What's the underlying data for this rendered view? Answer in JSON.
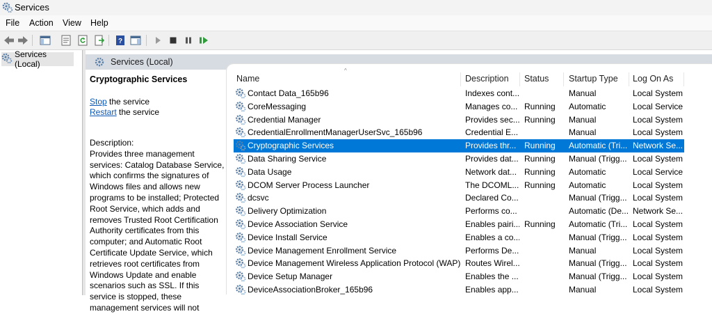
{
  "window": {
    "title": "Services"
  },
  "menu": [
    "File",
    "Action",
    "View",
    "Help"
  ],
  "tree": {
    "root_label": "Services (Local)"
  },
  "header": {
    "title": "Services (Local)"
  },
  "details": {
    "service_name": "Cryptographic Services",
    "stop_link": "Stop",
    "stop_suffix": " the service",
    "restart_link": "Restart",
    "restart_suffix": " the service",
    "description_label": "Description:",
    "description_text": "Provides three management services: Catalog Database Service, which confirms the signatures of Windows files and allows new programs to be installed; Protected Root Service, which adds and removes Trusted Root Certification Authority certificates from this computer; and Automatic Root Certificate Update Service, which retrieves root certificates from Windows Update and enable scenarios such as SSL. If this service is stopped, these management services will not"
  },
  "columns": {
    "name": "Name",
    "description": "Description",
    "status": "Status",
    "startup": "Startup Type",
    "logon": "Log On As"
  },
  "services": [
    {
      "name": "Contact Data_165b96",
      "description": "Indexes cont...",
      "status": "",
      "startup": "Manual",
      "logon": "Local System"
    },
    {
      "name": "CoreMessaging",
      "description": "Manages co...",
      "status": "Running",
      "startup": "Automatic",
      "logon": "Local Service"
    },
    {
      "name": "Credential Manager",
      "description": "Provides sec...",
      "status": "Running",
      "startup": "Manual",
      "logon": "Local System"
    },
    {
      "name": "CredentialEnrollmentManagerUserSvc_165b96",
      "description": "Credential E...",
      "status": "",
      "startup": "Manual",
      "logon": "Local System"
    },
    {
      "name": "Cryptographic Services",
      "description": "Provides thr...",
      "status": "Running",
      "startup": "Automatic (Tri...",
      "logon": "Network Se...",
      "selected": true
    },
    {
      "name": "Data Sharing Service",
      "description": "Provides dat...",
      "status": "Running",
      "startup": "Manual (Trigg...",
      "logon": "Local System"
    },
    {
      "name": "Data Usage",
      "description": "Network dat...",
      "status": "Running",
      "startup": "Automatic",
      "logon": "Local Service"
    },
    {
      "name": "DCOM Server Process Launcher",
      "description": "The DCOML...",
      "status": "Running",
      "startup": "Automatic",
      "logon": "Local System"
    },
    {
      "name": "dcsvc",
      "description": "Declared Co...",
      "status": "",
      "startup": "Manual (Trigg...",
      "logon": "Local System"
    },
    {
      "name": "Delivery Optimization",
      "description": "Performs co...",
      "status": "",
      "startup": "Automatic (De...",
      "logon": "Network Se..."
    },
    {
      "name": "Device Association Service",
      "description": "Enables pairi...",
      "status": "Running",
      "startup": "Automatic (Tri...",
      "logon": "Local System"
    },
    {
      "name": "Device Install Service",
      "description": "Enables a co...",
      "status": "",
      "startup": "Manual (Trigg...",
      "logon": "Local System"
    },
    {
      "name": "Device Management Enrollment Service",
      "description": "Performs De...",
      "status": "",
      "startup": "Manual",
      "logon": "Local System"
    },
    {
      "name": "Device Management Wireless Application Protocol (WAP) ...",
      "description": "Routes Wirel...",
      "status": "",
      "startup": "Manual (Trigg...",
      "logon": "Local System"
    },
    {
      "name": "Device Setup Manager",
      "description": "Enables the ...",
      "status": "",
      "startup": "Manual (Trigg...",
      "logon": "Local System"
    },
    {
      "name": "DeviceAssociationBroker_165b96",
      "description": "Enables app...",
      "status": "",
      "startup": "Manual",
      "logon": "Local System"
    }
  ],
  "toolbar": [
    "back-icon",
    "forward-icon",
    "show-hide-console-tree-icon",
    "properties-icon",
    "refresh-icon",
    "export-list-icon",
    "help-icon",
    "show-hide-action-pane-icon",
    "start-service-icon",
    "stop-service-icon",
    "pause-service-icon",
    "resume-service-icon"
  ],
  "colors": {
    "selection": "#0078d7",
    "link": "#0b57b5",
    "header_band": "#d7dbe2",
    "tree_selection": "#e5e5e5"
  }
}
